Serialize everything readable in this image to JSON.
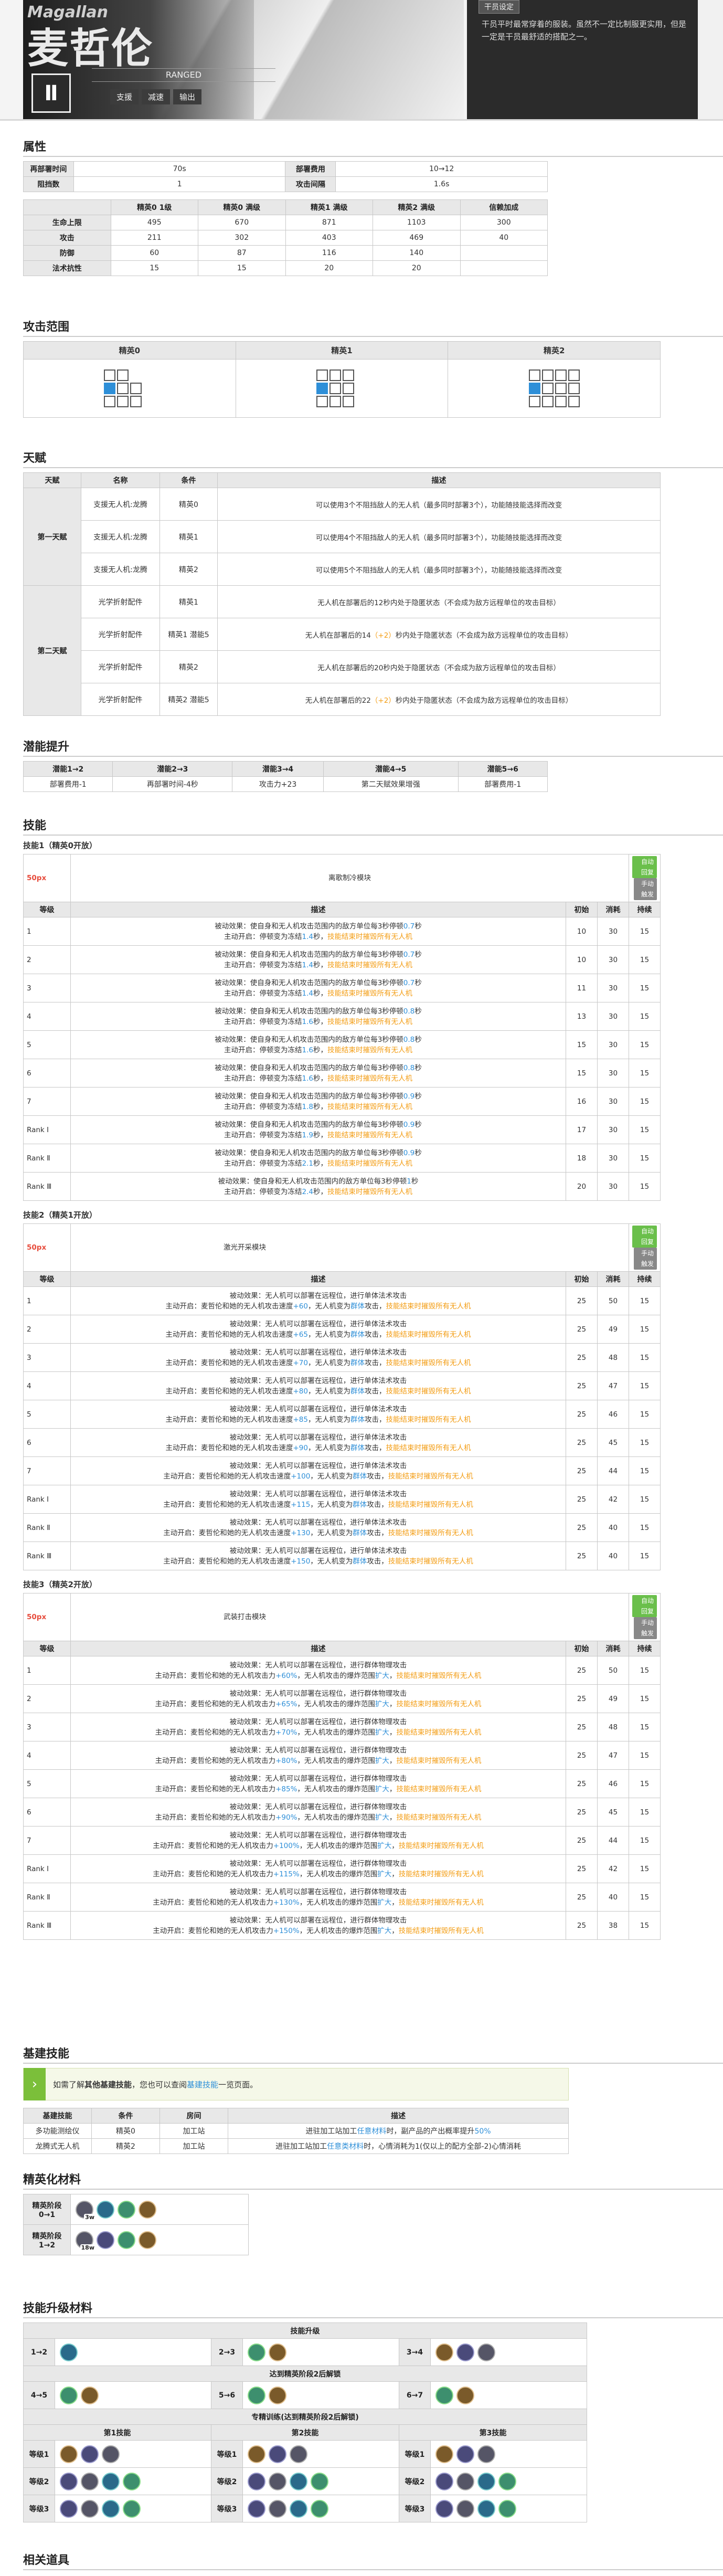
{
  "hero": {
    "name_en": "Magallan",
    "name_cn": "麦哲伦",
    "class_en": "RANGED",
    "tags": [
      "支援",
      "减速",
      "输出"
    ],
    "badge": "干员设定",
    "desc": "干员平时最常穿着的服装。虽然不一定比制服更实用，但是一定是干员最舒适的搭配之一。",
    "icon": "supporter-icon"
  },
  "attr": {
    "title": "属性",
    "r1": [
      {
        "k": "再部署时间",
        "v": "70s"
      },
      {
        "k": "部署费用",
        "v": "10→12"
      }
    ],
    "r2": [
      {
        "k": "阻挡数",
        "v": "1"
      },
      {
        "k": "攻击间隔",
        "v": "1.6s"
      }
    ],
    "headers": [
      "",
      "精英0 1级",
      "精英0 满级",
      "精英1 满级",
      "精英2 满级",
      "信赖加成"
    ],
    "rows": [
      [
        "生命上限",
        "495",
        "670",
        "871",
        "1103",
        "300"
      ],
      [
        "攻击",
        "211",
        "302",
        "403",
        "469",
        "40"
      ],
      [
        "防御",
        "60",
        "87",
        "116",
        "140",
        ""
      ],
      [
        "法术抗性",
        "15",
        "15",
        "20",
        "20",
        ""
      ]
    ]
  },
  "range": {
    "title": "攻击范围",
    "cols": [
      "精英0",
      "精英1",
      "精英2"
    ]
  },
  "talent": {
    "title": "天赋",
    "headers": [
      "天赋",
      "名称",
      "条件",
      "描述"
    ],
    "t1": "第一天赋",
    "t2": "第二天赋",
    "rows": [
      [
        "支援无人机:龙腾",
        "精英0",
        "可以使用3个不阻挡敌人的无人机（最多同时部署3个），功能随技能选择而改变"
      ],
      [
        "支援无人机:龙腾",
        "精英1",
        "可以使用4个不阻挡敌人的无人机（最多同时部署3个），功能随技能选择而改变"
      ],
      [
        "支援无人机:龙腾",
        "精英2",
        "可以使用5个不阻挡敌人的无人机（最多同时部署3个），功能随技能选择而改变"
      ],
      [
        "光学折射配件",
        "精英1",
        "无人机在部署后的12秒内处于隐匿状态（不会成为敌方远程单位的攻击目标）"
      ],
      [
        "光学折射配件",
        "精英1 潜能5",
        "无人机在部署后的",
        "（+2）",
        "秒内处于隐匿状态（不会成为敌方远程单位的攻击目标）",
        "14"
      ],
      [
        "光学折射配件",
        "精英2",
        "无人机在部署后的20秒内处于隐匿状态（不会成为敌方远程单位的攻击目标）"
      ],
      [
        "光学折射配件",
        "精英2 潜能5",
        "无人机在部署后的",
        "（+2）",
        "秒内处于隐匿状态（不会成为敌方远程单位的攻击目标）",
        "22"
      ]
    ]
  },
  "potential": {
    "title": "潜能提升",
    "headers": [
      "潜能1→2",
      "潜能2→3",
      "潜能3→4",
      "潜能4→5",
      "潜能5→6"
    ],
    "values": [
      "部署费用-1",
      "再部署时间-4秒",
      "攻击力+23",
      "第二天赋效果增强",
      "部署费用-1"
    ]
  },
  "skills": {
    "title": "技能",
    "s1": {
      "title": "技能1（精英0开放）",
      "sp": "50px",
      "name": "离歌制冷模块",
      "tag1": "自动回复",
      "tag2": "手动触发",
      "headers": [
        "等级",
        "描述",
        "初始",
        "消耗",
        "持续"
      ],
      "rows": [
        [
          "1",
          "被动效果：使自身和无人机攻击范围内的敌方单位每3秒停顿",
          "0.7",
          "秒",
          "主动开启：停顿变为冻结",
          1.4,
          "秒，",
          "技能结束时摧毁所有无人机",
          "10",
          "30",
          "15"
        ],
        [
          "2",
          "被动效果：使自身和无人机攻击范围内的敌方单位每3秒停顿",
          "0.7",
          "秒",
          "主动开启：停顿变为冻结",
          1.4,
          "秒，",
          "技能结束时摧毁所有无人机",
          "10",
          "30",
          "15"
        ],
        [
          "3",
          "被动效果：使自身和无人机攻击范围内的敌方单位每3秒停顿",
          "0.7",
          "秒",
          "主动开启：停顿变为冻结",
          1.4,
          "秒，",
          "技能结束时摧毁所有无人机",
          "11",
          "30",
          "15"
        ],
        [
          "4",
          "被动效果：使自身和无人机攻击范围内的敌方单位每3秒停顿",
          "0.8",
          "秒",
          "主动开启：停顿变为冻结",
          1.6,
          "秒，",
          "技能结束时摧毁所有无人机",
          "13",
          "30",
          "15"
        ],
        [
          "5",
          "被动效果：使自身和无人机攻击范围内的敌方单位每3秒停顿",
          "0.8",
          "秒",
          "主动开启：停顿变为冻结",
          1.6,
          "秒，",
          "技能结束时摧毁所有无人机",
          "15",
          "30",
          "15"
        ],
        [
          "6",
          "被动效果：使自身和无人机攻击范围内的敌方单位每3秒停顿",
          "0.8",
          "秒",
          "主动开启：停顿变为冻结",
          1.6,
          "秒，",
          "技能结束时摧毁所有无人机",
          "15",
          "30",
          "15"
        ],
        [
          "7",
          "被动效果：使自身和无人机攻击范围内的敌方单位每3秒停顿",
          "0.9",
          "秒",
          "主动开启：停顿变为冻结",
          1.8,
          "秒，",
          "技能结束时摧毁所有无人机",
          "16",
          "30",
          "15"
        ],
        [
          "Rank Ⅰ",
          "被动效果：使自身和无人机攻击范围内的敌方单位每3秒停顿",
          "0.9",
          "秒",
          "主动开启：停顿变为冻结",
          1.9,
          "秒，",
          "技能结束时摧毁所有无人机",
          "17",
          "30",
          "15"
        ],
        [
          "Rank Ⅱ",
          "被动效果：使自身和无人机攻击范围内的敌方单位每3秒停顿",
          "0.9",
          "秒",
          "主动开启：停顿变为冻结",
          2.1,
          "秒，",
          "技能结束时摧毁所有无人机",
          "18",
          "30",
          "15"
        ],
        [
          "Rank Ⅲ",
          "被动效果：使自身和无人机攻击范围内的敌方单位每3秒停顿",
          "1",
          "秒",
          "主动开启：停顿变为冻结",
          2.4,
          "秒，",
          "技能结束时摧毁所有无人机",
          "20",
          "30",
          "15"
        ]
      ]
    },
    "s2": {
      "title": "技能2（精英1开放）",
      "sp": "50px",
      "name": "激光开采模块",
      "tag1": "自动回复",
      "tag2": "手动触发",
      "headers": [
        "等级",
        "描述",
        "初始",
        "消耗",
        "持续"
      ],
      "rows": [
        [
          "1",
          "被动效果：无人机可以部署在远程位，进行单体法术攻击",
          "主动开启：麦哲伦和她的无人机攻击速度",
          "+60",
          "，无人机变为",
          "群体",
          "攻击，",
          "技能结束时摧毁所有无人机",
          "25",
          "50",
          "15"
        ],
        [
          "2",
          "被动效果：无人机可以部署在远程位，进行单体法术攻击",
          "主动开启：麦哲伦和她的无人机攻击速度",
          "+65",
          "，无人机变为",
          "群体",
          "攻击，",
          "技能结束时摧毁所有无人机",
          "25",
          "49",
          "15"
        ],
        [
          "3",
          "被动效果：无人机可以部署在远程位，进行单体法术攻击",
          "主动开启：麦哲伦和她的无人机攻击速度",
          "+70",
          "，无人机变为",
          "群体",
          "攻击，",
          "技能结束时摧毁所有无人机",
          "25",
          "48",
          "15"
        ],
        [
          "4",
          "被动效果：无人机可以部署在远程位，进行单体法术攻击",
          "主动开启：麦哲伦和她的无人机攻击速度",
          "+80",
          "，无人机变为",
          "群体",
          "攻击，",
          "技能结束时摧毁所有无人机",
          "25",
          "47",
          "15"
        ],
        [
          "5",
          "被动效果：无人机可以部署在远程位，进行单体法术攻击",
          "主动开启：麦哲伦和她的无人机攻击速度",
          "+85",
          "，无人机变为",
          "群体",
          "攻击，",
          "技能结束时摧毁所有无人机",
          "25",
          "46",
          "15"
        ],
        [
          "6",
          "被动效果：无人机可以部署在远程位，进行单体法术攻击",
          "主动开启：麦哲伦和她的无人机攻击速度",
          "+90",
          "，无人机变为",
          "群体",
          "攻击，",
          "技能结束时摧毁所有无人机",
          "25",
          "45",
          "15"
        ],
        [
          "7",
          "被动效果：无人机可以部署在远程位，进行单体法术攻击",
          "主动开启：麦哲伦和她的无人机攻击速度",
          "+100",
          "，无人机变为",
          "群体",
          "攻击，",
          "技能结束时摧毁所有无人机",
          "25",
          "44",
          "15"
        ],
        [
          "Rank Ⅰ",
          "被动效果：无人机可以部署在远程位，进行单体法术攻击",
          "主动开启：麦哲伦和她的无人机攻击速度",
          "+115",
          "，无人机变为",
          "群体",
          "攻击，",
          "技能结束时摧毁所有无人机",
          "25",
          "42",
          "15"
        ],
        [
          "Rank Ⅱ",
          "被动效果：无人机可以部署在远程位，进行单体法术攻击",
          "主动开启：麦哲伦和她的无人机攻击速度",
          "+130",
          "，无人机变为",
          "群体",
          "攻击，",
          "技能结束时摧毁所有无人机",
          "25",
          "40",
          "15"
        ],
        [
          "Rank Ⅲ",
          "被动效果：无人机可以部署在远程位，进行单体法术攻击",
          "主动开启：麦哲伦和她的无人机攻击速度",
          "+150",
          "，无人机变为",
          "群体",
          "攻击，",
          "技能结束时摧毁所有无人机",
          "25",
          "40",
          "15"
        ]
      ]
    },
    "s3": {
      "title": "技能3（精英2开放）",
      "sp": "50px",
      "name": "武装打击模块",
      "tag1": "自动回复",
      "tag2": "手动触发",
      "headers": [
        "等级",
        "描述",
        "初始",
        "消耗",
        "持续"
      ],
      "rows": [
        [
          "1",
          "被动效果：无人机可以部署在远程位，进行群体物理攻击",
          "主动开启：麦哲伦和她的无人机攻击力",
          "+60%",
          "，无人机攻击的爆炸范围",
          "扩大",
          "，",
          "技能结束时摧毁所有无人机",
          "25",
          "50",
          "15"
        ],
        [
          "2",
          "被动效果：无人机可以部署在远程位，进行群体物理攻击",
          "主动开启：麦哲伦和她的无人机攻击力",
          "+65%",
          "，无人机攻击的爆炸范围",
          "扩大",
          "，",
          "技能结束时摧毁所有无人机",
          "25",
          "49",
          "15"
        ],
        [
          "3",
          "被动效果：无人机可以部署在远程位，进行群体物理攻击",
          "主动开启：麦哲伦和她的无人机攻击力",
          "+70%",
          "，无人机攻击的爆炸范围",
          "扩大",
          "，",
          "技能结束时摧毁所有无人机",
          "25",
          "48",
          "15"
        ],
        [
          "4",
          "被动效果：无人机可以部署在远程位，进行群体物理攻击",
          "主动开启：麦哲伦和她的无人机攻击力",
          "+80%",
          "，无人机攻击的爆炸范围",
          "扩大",
          "，",
          "技能结束时摧毁所有无人机",
          "25",
          "47",
          "15"
        ],
        [
          "5",
          "被动效果：无人机可以部署在远程位，进行群体物理攻击",
          "主动开启：麦哲伦和她的无人机攻击力",
          "+85%",
          "，无人机攻击的爆炸范围",
          "扩大",
          "，",
          "技能结束时摧毁所有无人机",
          "25",
          "46",
          "15"
        ],
        [
          "6",
          "被动效果：无人机可以部署在远程位，进行群体物理攻击",
          "主动开启：麦哲伦和她的无人机攻击力",
          "+90%",
          "，无人机攻击的爆炸范围",
          "扩大",
          "，",
          "技能结束时摧毁所有无人机",
          "25",
          "45",
          "15"
        ],
        [
          "7",
          "被动效果：无人机可以部署在远程位，进行群体物理攻击",
          "主动开启：麦哲伦和她的无人机攻击力",
          "+100%",
          "，无人机攻击的爆炸范围",
          "扩大",
          "，",
          "技能结束时摧毁所有无人机",
          "25",
          "44",
          "15"
        ],
        [
          "Rank Ⅰ",
          "被动效果：无人机可以部署在远程位，进行群体物理攻击",
          "主动开启：麦哲伦和她的无人机攻击力",
          "+115%",
          "，无人机攻击的爆炸范围",
          "扩大",
          "，",
          "技能结束时摧毁所有无人机",
          "25",
          "42",
          "15"
        ],
        [
          "Rank Ⅱ",
          "被动效果：无人机可以部署在远程位，进行群体物理攻击",
          "主动开启：麦哲伦和她的无人机攻击力",
          "+130%",
          "，无人机攻击的爆炸范围",
          "扩大",
          "，",
          "技能结束时摧毁所有无人机",
          "25",
          "40",
          "15"
        ],
        [
          "Rank Ⅲ",
          "被动效果：无人机可以部署在远程位，进行群体物理攻击",
          "主动开启：麦哲伦和她的无人机攻击力",
          "+150%",
          "，无人机攻击的爆炸范围",
          "扩大",
          "，",
          "技能结束时摧毁所有无人机",
          "25",
          "38",
          "15"
        ]
      ]
    }
  },
  "base": {
    "title": "基建技能",
    "note_pre": "如需了解",
    "note_bold": "其他基建技能",
    "note_mid": "，您也可以查阅",
    "note_link": "基建技能",
    "note_post": "一览页面。",
    "headers": [
      "基建技能",
      "条件",
      "房间",
      "描述"
    ],
    "rows": [
      [
        "多功能测绘仪",
        "精英0",
        "加工站",
        "进驻加工站加工",
        "任意材料",
        "时，副产品的产出概率提升",
        "50%"
      ],
      [
        "龙腾式无人机",
        "精英2",
        "加工站",
        "进驻加工站加工",
        "任意类材料",
        "时，心情消耗为1(仅以上的配方全部-2)心情消耗"
      ]
    ]
  },
  "elite": {
    "title": "精英化材料",
    "rows": [
      {
        "label": "精英阶段 0→1",
        "counts": [
          "3w",
          "",
          "",
          ""
        ]
      },
      {
        "label": "精英阶段 1→2",
        "counts": [
          "18w",
          "",
          "",
          ""
        ]
      }
    ]
  },
  "upgrade": {
    "title": "技能升级材料",
    "skill_up": "技能升级",
    "lv": [
      "1→2",
      "2→3",
      "3→4",
      "4→5",
      "5→6",
      "6→7"
    ],
    "e2": "达到精英阶段2后解锁",
    "mastery": "专精训练(达到精英阶段2后解锁)",
    "cols": [
      "第1技能",
      "第2技能",
      "第3技能"
    ],
    "ranks": [
      "等级1",
      "等级2",
      "等级3"
    ]
  },
  "related": {
    "title": "相关道具"
  }
}
